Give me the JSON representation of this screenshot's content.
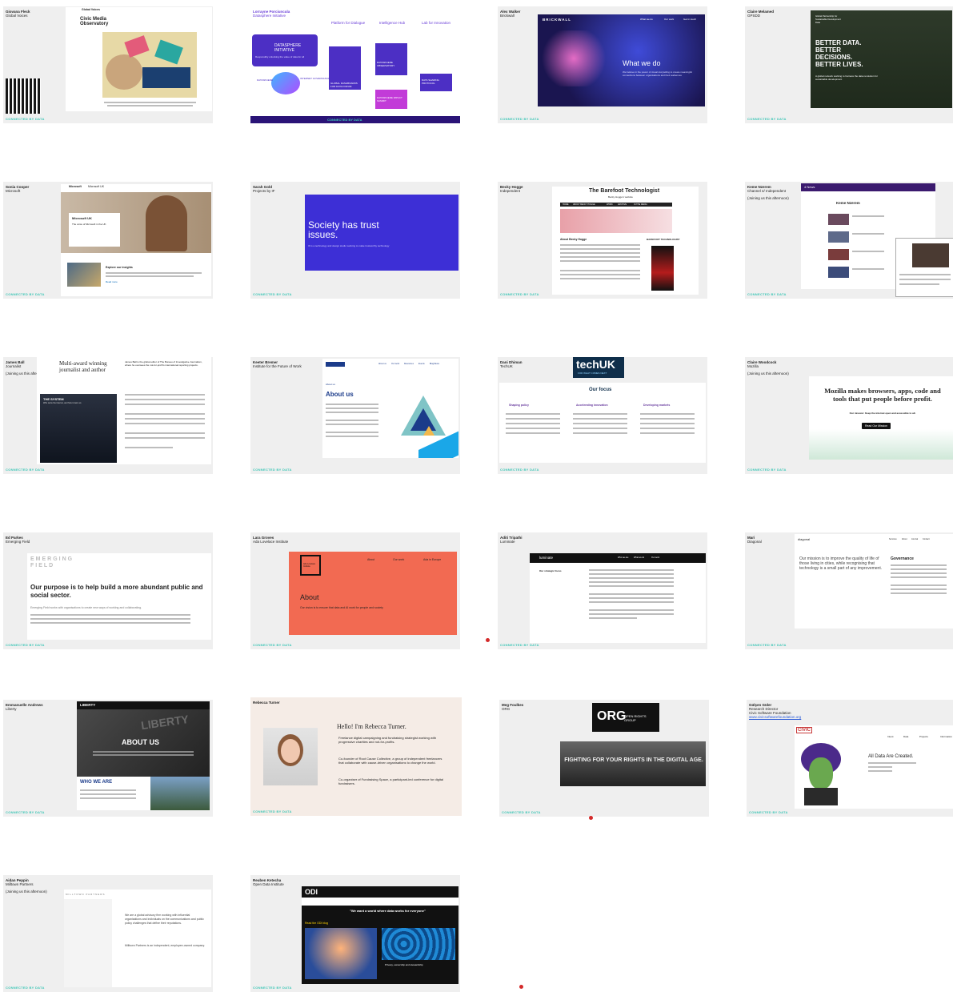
{
  "footer_label": "CONNECTED BY DATA",
  "slides": [
    {
      "name": "Giovana Fleck",
      "role": "Global Voices",
      "site_logo": "Civic Media Observatory",
      "site_brand": "Global Voices",
      "site_caption": "Civic Media Observatory"
    },
    {
      "name": "Lorrayne Porciuncula",
      "role": "Datasphere Initiative",
      "pillars": [
        "Platform for Dialogue",
        "Intelligence Hub",
        "Lab for Innovation"
      ],
      "logo": "DATASPHERE INITIATIVE",
      "logo_tag": "Responsibly unlocking the value of data for all",
      "cards": [
        "GLOBAL DASHBOARDS FOR DATA FORUM",
        "DATASPHERE OBSERVATORY",
        "DATA SHARING PROTOCOL",
        "DATASPHERE IMPACT SUMMIT"
      ],
      "bubble_left": "DATASPHERE",
      "bubble_right": "INTERNET GOVERNANCE"
    },
    {
      "name": "Alex Walker",
      "role": "Brickwall",
      "site_brand": "BRICKWALL",
      "nav": [
        "What we do",
        "Our work",
        "Get in touch"
      ],
      "headline": "What we do",
      "body": "We believe in the power of visual storytelling to create meaningful connections between organisations and their audiences"
    },
    {
      "name": "Claire Melamed",
      "role": "GPSDD",
      "site_brand": "Global Partnership for Sustainable Development Data",
      "headline": "BETTER DATA. BETTER DECISIONS. BETTER LIVES.",
      "body": "A global network working to harness the data revolution for sustainable development"
    },
    {
      "name": "Sonia Cooper",
      "role": "Microsoft",
      "site_brand": "Microsoft",
      "site_section": "Microsoft UK",
      "card_title": "Microsoft UK",
      "card_body": "The voice of Microsoft in the UK",
      "card2_title": "Explore our insights",
      "card2_link": "Read more"
    },
    {
      "name": "Sarah Gold",
      "role": "Projects by IF",
      "headline": "Society has trust issues.",
      "body": "IF is a technology and design studio working to make trustworthy technology"
    },
    {
      "name": "Becky Hogge",
      "role": "Independent",
      "site_title": "The Barefoot Technologist",
      "site_sub": "Becky Hogge's website",
      "nav": [
        "HOME",
        "ABOUT BECKY HOGGE",
        "WORK",
        "ARCHIVE",
        "IN THE MEDIA"
      ],
      "about_title": "About Becky Hogge",
      "side_title": "BAREFOOT TECHNOLOGIST"
    },
    {
      "name": "Keme Nzerem",
      "role": "Channel 4/ Independent",
      "note": "(Joining us this afternoon)",
      "site_brand": "4 News",
      "page_title": "Keme Nzerem"
    },
    {
      "name": "James Ball",
      "role": "Journalist",
      "note": "(Joining us this afternoon)",
      "headline": "Multi-award winning journalist and author",
      "book_title": "THE SYSTEM",
      "book_sub": "Who owns the internet, and how it owns us",
      "bio": "James Ball is the global editor of The Bureau of Investigative Journalism, where he oversees the not-for-profit's international reporting projects."
    },
    {
      "name": "Keeter Bremer",
      "role": "Institute for the Future of Work",
      "site_brand": "Institute for the Future of Work",
      "nav": [
        "About us",
        "Our work",
        "Resources",
        "Events",
        "Blog/News"
      ],
      "section_small": "About us",
      "headline": "About us"
    },
    {
      "name": "Dani Dhiman",
      "role": "TechUK",
      "logo": "techUK",
      "logo_tag": "FOR WHAT COMES NEXT",
      "section": "Our focus",
      "columns": [
        "Shaping policy",
        "Accelerating innovation",
        "Developing markets"
      ]
    },
    {
      "name": "Claire Woodcock",
      "role": "Mozilla",
      "note": "(Joining us this afternoon)",
      "headline": "Mozilla makes browsers, apps, code and tools that put people before profit.",
      "subline": "Our mission: Keep the internet open and accessible to all.",
      "button": "Read Our Mission"
    },
    {
      "name": "Ed Parkes",
      "role": "Emerging Field",
      "logo": "EMERGING FIELD",
      "headline": "Our purpose is to help build a more abundant public and social sector.",
      "body": "Emerging Field works with organisations to create new ways of working and collaborating."
    },
    {
      "name": "Lara Groves",
      "role": "Ada Lovelace Institute",
      "logo": "Ada Lovelace Institute",
      "nav": [
        "About",
        "Our work",
        "Ada in Europe"
      ],
      "headline": "About",
      "body": "Our vision is to ensure that data and AI work for people and society"
    },
    {
      "name": "Aditi Tripathi",
      "role": "Luminate",
      "site_brand": "luminate",
      "nav": [
        "Who we are",
        "What we do",
        "Our work"
      ],
      "sub": "Our strategic focus"
    },
    {
      "name": "Mari",
      "role": "Diagonal",
      "site_brand": "diagonal",
      "nav": [
        "Services",
        "About",
        "Journal",
        "Contact"
      ],
      "mission": "Our mission is to improve the quality of life of those living in cities, while recognising that technology is a small part of any improvement.",
      "side_title": "Governance"
    },
    {
      "name": "Emmanuelle Andrews",
      "role": "Liberty",
      "site_brand": "LIBERTY",
      "headline": "ABOUT US",
      "sub": "WHO WE ARE",
      "sign": "LIBERTY"
    },
    {
      "name": "Rebecca Turner",
      "role": "",
      "greeting": "Hello! I'm Rebecca Turner.",
      "bullets": [
        "Freelance digital campaigning and fundraising strategist working with progressive charities and not-for-profits.",
        "Co-founder of Root Cause Collective, a group of independent freelancers that collaborate with cause-driven organisations to change the world.",
        "Co-organiser of Fundraising Space, a participant-led conference for digital fundraisers."
      ]
    },
    {
      "name": "Meg Foulkes",
      "role": "ORG",
      "logo_big": "ORG",
      "logo_text": "OPEN RIGHTS GROUP",
      "banner": "FIGHTING FOR YOUR RIGHTS IN THE DIGITAL AGE."
    },
    {
      "name": "Gülşen Güler",
      "role": "Research Director",
      "role2": "Civic Software Foundation",
      "link": "www.civicsoftwarefoundation.org",
      "site_brand": "CIVIC",
      "headline": "All Data Are Created.",
      "nav": [
        "Intent",
        "Data",
        "Projects",
        "Information"
      ]
    },
    {
      "name": "Aidan Peppin",
      "role": "Milltown Partners",
      "note": "(Joining us this afternoon)",
      "site_brand": "MILLTOWN PARTNERS",
      "body": "We are a global advisory firm working with influential organisations and individuals on the communications and public policy challenges that define their reputations.",
      "body2": "Milltown Partners is an independent, employee-owned company."
    },
    {
      "name": "Reuben Ketecha",
      "role": "Open Data Institute",
      "site_brand": "ODI",
      "headline": "\"We want a world where data works for everyone\"",
      "tab": "Read the ODI blog",
      "card_title": "Privacy, ownership and stewardship"
    }
  ]
}
